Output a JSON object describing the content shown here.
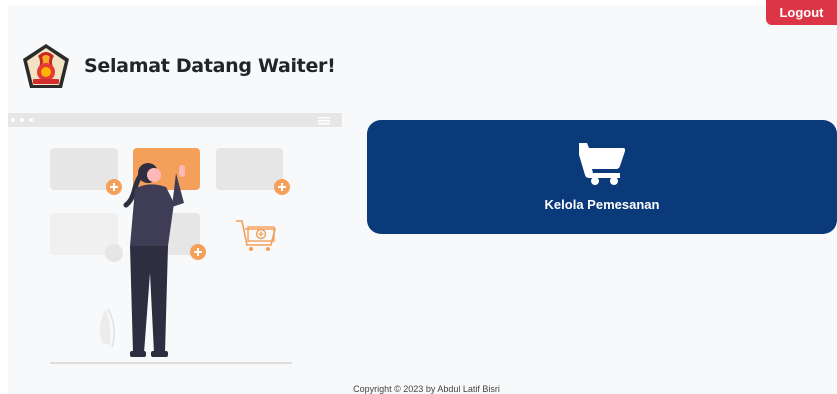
{
  "header": {
    "logout_label": "Logout",
    "welcome_title": "Selamat Datang Waiter!"
  },
  "menu": {
    "cards": [
      {
        "label": "Kelola Pemesanan",
        "icon": "shopping-cart-icon"
      }
    ]
  },
  "footer": {
    "copyright": "Copyright © 2023 by Abdul Latif Bisri"
  },
  "colors": {
    "logout_button": "#dc3545",
    "card_background": "#0b3a7a",
    "page_background": "#f8f9fa",
    "illustration_accent": "#f5a05a"
  }
}
